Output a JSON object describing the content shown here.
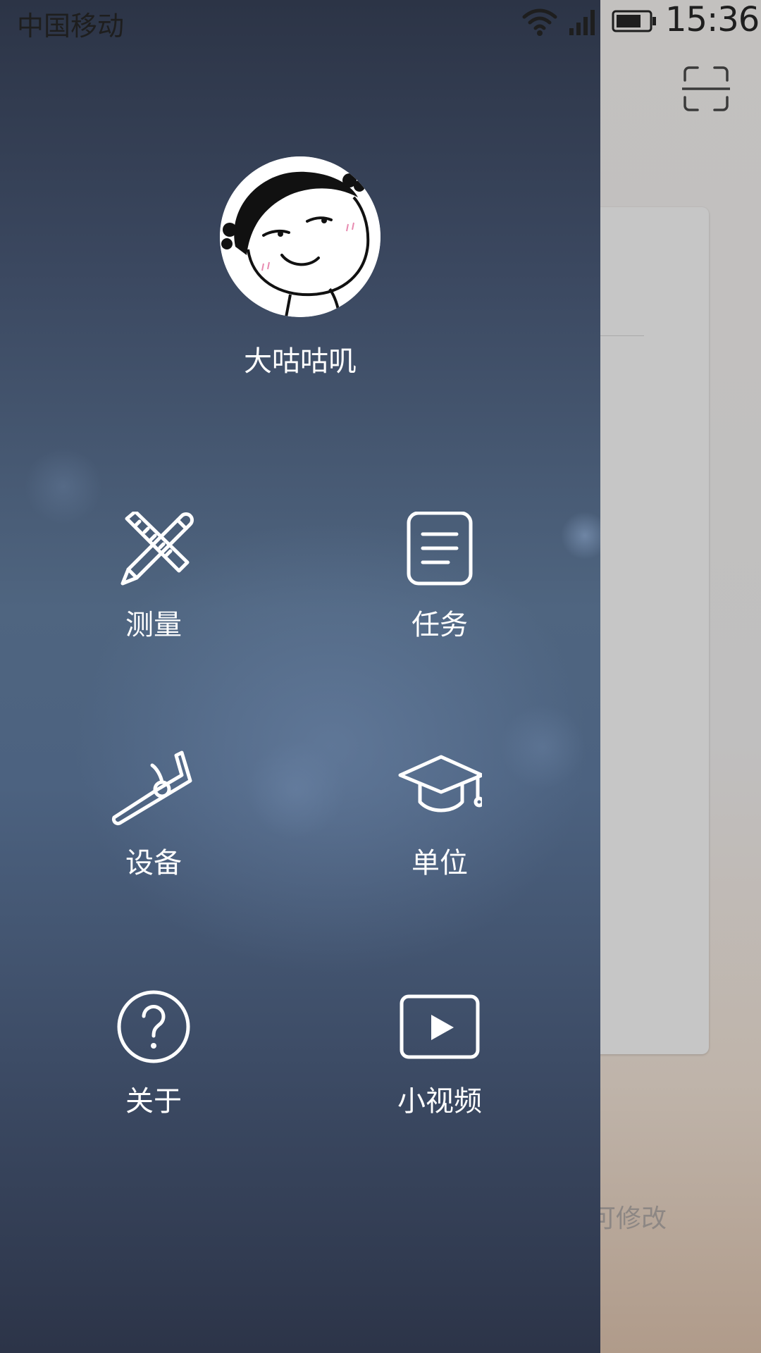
{
  "status_bar": {
    "carrier": "中国移动",
    "time": "15:36"
  },
  "background_app": {
    "hint_text": "可修改"
  },
  "profile": {
    "username": "大咕咕叽"
  },
  "menu": {
    "items": [
      {
        "label": "测量",
        "icon": "ruler-pencil-icon"
      },
      {
        "label": "任务",
        "icon": "task-list-icon"
      },
      {
        "label": "设备",
        "icon": "device-icon"
      },
      {
        "label": "单位",
        "icon": "graduation-cap-icon"
      },
      {
        "label": "关于",
        "icon": "question-icon"
      },
      {
        "label": "小视频",
        "icon": "video-play-icon"
      }
    ]
  },
  "colors": {
    "drawer_top": "#2c3446",
    "drawer_mid": "#4f6580",
    "drawer_bottom": "#2c3448",
    "text_on_drawer": "#ffffff",
    "background_app": "#c3c1bf"
  }
}
